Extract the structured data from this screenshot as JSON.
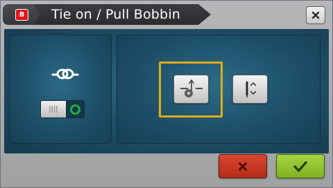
{
  "header": {
    "logo_text": "B",
    "title": "Tie on / Pull Bobbin",
    "close_icon": "close-icon"
  },
  "left_panel": {
    "knot_icon": "knot-icon",
    "toggle": {
      "left_icon": "stitch-lines-icon",
      "right_icon": "ring-icon",
      "state": "right",
      "active_color": "#1fae3a"
    }
  },
  "right_panel": {
    "buttons": [
      {
        "icon": "tie-on-icon",
        "selected": true
      },
      {
        "icon": "pull-bobbin-icon",
        "selected": false
      }
    ],
    "selection_color": "#e3ad14"
  },
  "footer": {
    "cancel_icon": "cancel-x-icon",
    "confirm_icon": "checkmark-icon",
    "cancel_color": "#c4391f",
    "confirm_color": "#8cc22e"
  }
}
